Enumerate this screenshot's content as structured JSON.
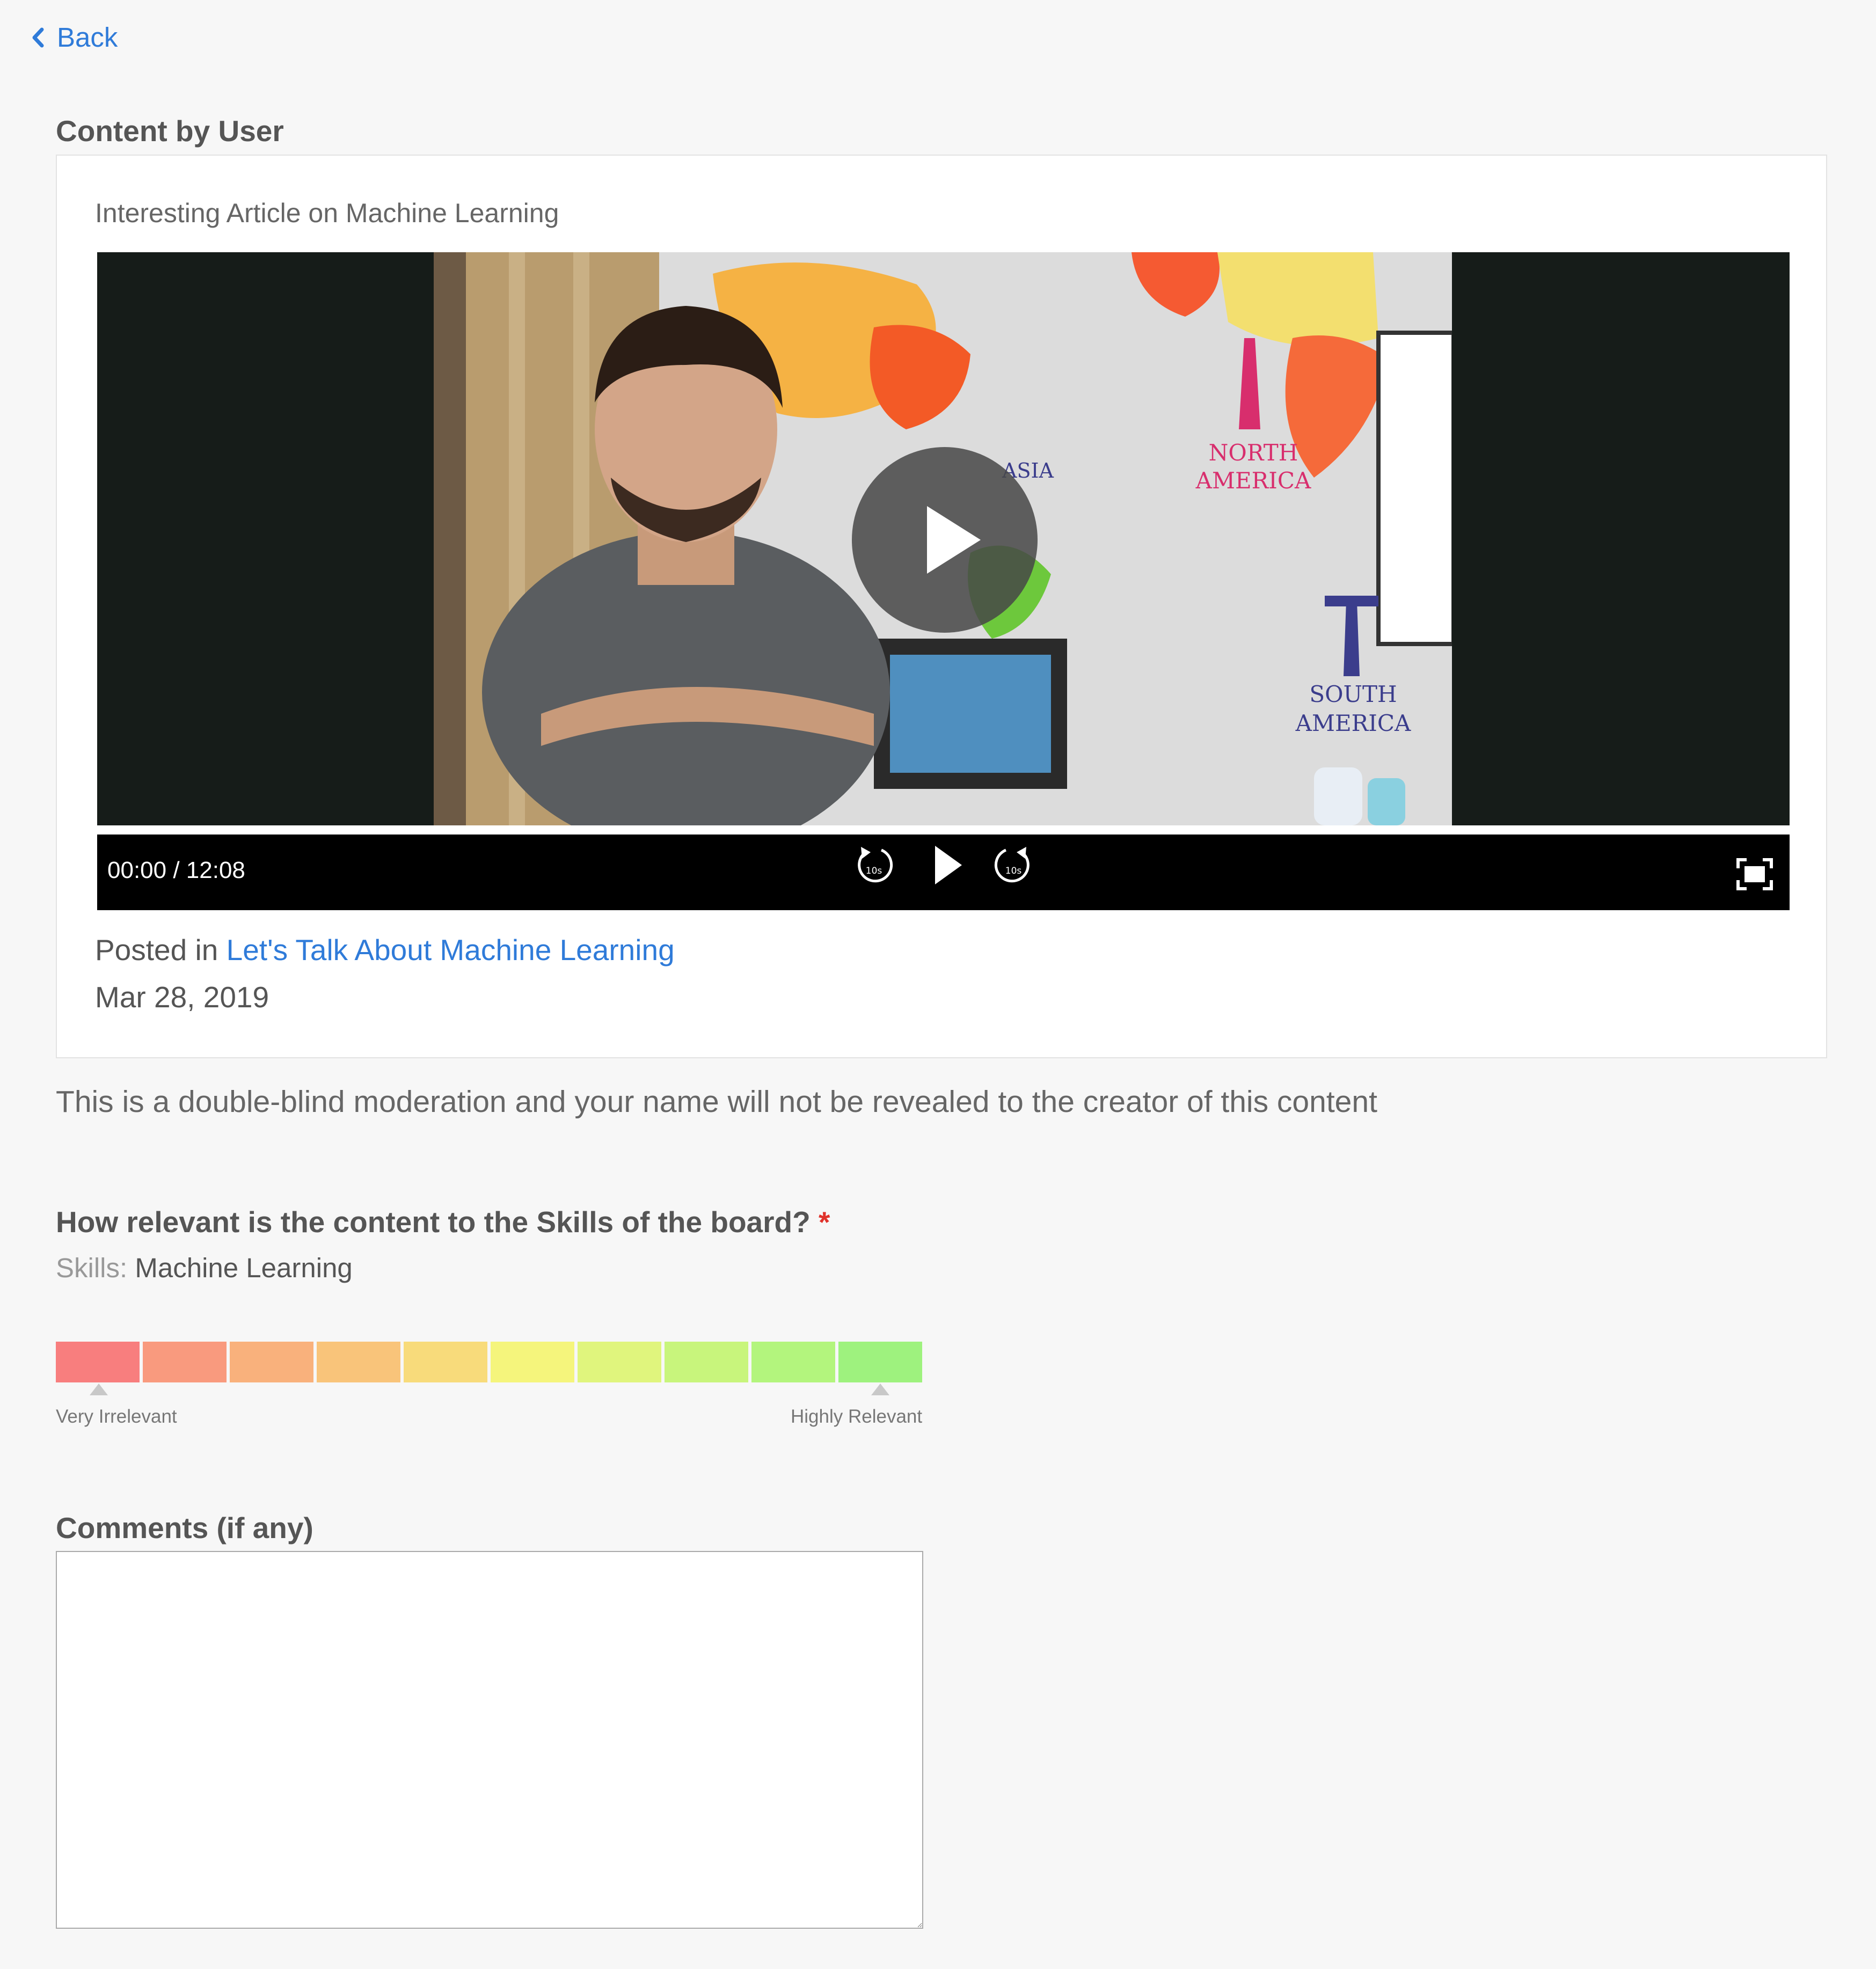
{
  "nav": {
    "back_label": "Back"
  },
  "content_section": {
    "title": "Content by User",
    "card_title": "Interesting Article on Machine Learning",
    "video": {
      "time": "00:00 / 12:08",
      "map_labels": {
        "asia": "ASIA",
        "north_america_1": "NORTH",
        "north_america_2": "AMERICA",
        "south_america_1": "SOUTH",
        "south_america_2": "AMERICA"
      },
      "rewind_badge": "10s",
      "forward_badge": "10s"
    },
    "posted_in_prefix": "Posted in",
    "posted_in_link": "Let's Talk About Machine Learning",
    "date": "Mar 28, 2019"
  },
  "note": "This is a double-blind moderation and your name will not be revealed to the creator of this content",
  "question": {
    "text": "How relevant is the content to the Skills of the board?",
    "required_marker": "*",
    "skills_label": "Skills:",
    "skills_value": "Machine Learning"
  },
  "rating_scale": {
    "colors": [
      "#f87e7e",
      "#f99a7e",
      "#f9b17c",
      "#f9c47a",
      "#f8db7b",
      "#f5f57c",
      "#e0f57d",
      "#c8f57c",
      "#b3f57d",
      "#9ef27e"
    ],
    "min_label": "Very Irrelevant",
    "max_label": "Highly Relevant"
  },
  "comments": {
    "title": "Comments (if any)",
    "value": ""
  }
}
